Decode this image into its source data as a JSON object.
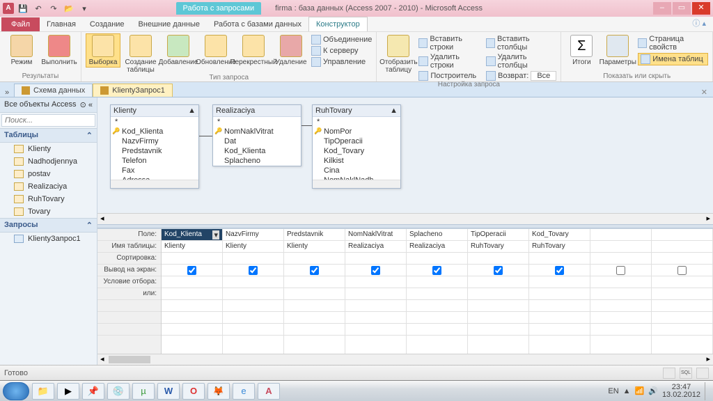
{
  "title": {
    "context_tab": "Работа с запросами",
    "doc": "firma : база данных (Access 2007 - 2010) - Microsoft Access",
    "context_sub": "Конструктор"
  },
  "tabs": {
    "file": "Файл",
    "t1": "Главная",
    "t2": "Создание",
    "t3": "Внешние данные",
    "t4": "Работа с базами данных"
  },
  "ribbon": {
    "g1": {
      "label": "Результаты",
      "b1": "Режим",
      "b2": "Выполнить"
    },
    "g2": {
      "label": "Тип запроса",
      "b1": "Выборка",
      "b2": "Создание таблицы",
      "b3": "Добавление",
      "b4": "Обновление",
      "b5": "Перекрестный",
      "b6": "Удаление",
      "s1": "Объединение",
      "s2": "К серверу",
      "s3": "Управление"
    },
    "g3": {
      "label": "Настройка запроса",
      "b1": "Отобразить таблицу",
      "s1": "Вставить строки",
      "s2": "Удалить строки",
      "s3": "Построитель",
      "s4": "Вставить столбцы",
      "s5": "Удалить столбцы",
      "s6": "Возврат:",
      "s6v": "Все"
    },
    "g4": {
      "label": "Показать или скрыть",
      "b1": "Итоги",
      "b2": "Параметры",
      "s1": "Страница свойств",
      "s2": "Имена таблиц"
    }
  },
  "doctabs": {
    "t1": "Схема данных",
    "t2": "KlientyЗапрос1"
  },
  "nav": {
    "head": "Все объекты Access",
    "search": "Поиск...",
    "cat1": "Таблицы",
    "tables": [
      "Klienty",
      "Nadhodjennya",
      "postav",
      "Realizaciya",
      "RuhTovary",
      "Tovary"
    ],
    "cat2": "Запросы",
    "queries": [
      "KlientyЗапрос1"
    ]
  },
  "diagram": {
    "t1": {
      "name": "Klienty",
      "fields": [
        "Kod_Klienta",
        "NazvFirmy",
        "Predstavnik",
        "Telefon",
        "Fax",
        "Adressa"
      ],
      "key": 0
    },
    "t2": {
      "name": "Realizaciya",
      "fields": [
        "NomNaklVitrat",
        "Dat",
        "Kod_Klienta",
        "Splacheno"
      ],
      "key": 0
    },
    "t3": {
      "name": "RuhTovary",
      "fields": [
        "NomPor",
        "TipOperacii",
        "Kod_Tovary",
        "Kilkist",
        "Cina",
        "NomNaklNadh"
      ],
      "key": 0
    }
  },
  "grid": {
    "rows": {
      "r1": "Поле:",
      "r2": "Имя таблицы:",
      "r3": "Сортировка:",
      "r4": "Вывод на экран:",
      "r5": "Условие отбора:",
      "r6": "или:"
    },
    "cols": [
      {
        "field": "Kod_Klienta",
        "table": "Klienty",
        "show": true,
        "sel": true
      },
      {
        "field": "NazvFirmy",
        "table": "Klienty",
        "show": true
      },
      {
        "field": "Predstavnik",
        "table": "Klienty",
        "show": true
      },
      {
        "field": "NomNaklVitrat",
        "table": "Realizaciya",
        "show": true
      },
      {
        "field": "Splacheno",
        "table": "Realizaciya",
        "show": true
      },
      {
        "field": "TipOperacii",
        "table": "RuhTovary",
        "show": true
      },
      {
        "field": "Kod_Tovary",
        "table": "RuhTovary",
        "show": true
      },
      {
        "field": "",
        "table": "",
        "show": false
      },
      {
        "field": "",
        "table": "",
        "show": false
      }
    ]
  },
  "status": {
    "text": "Готово",
    "lang": "EN"
  },
  "tray": {
    "time": "23:47",
    "date": "13.02.2012"
  }
}
